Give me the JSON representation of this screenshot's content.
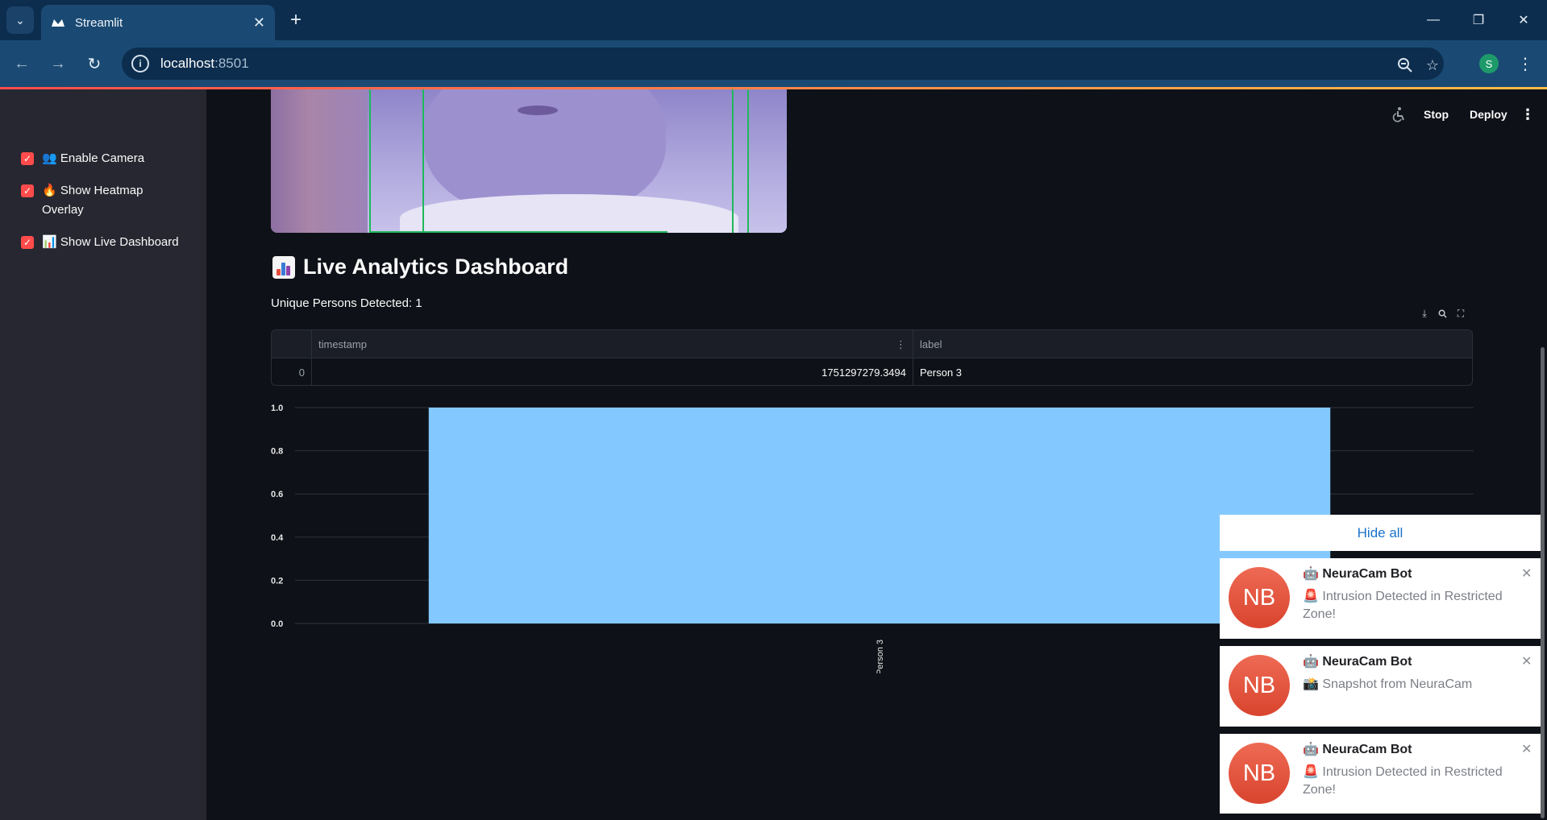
{
  "browser": {
    "tab_title": "Streamlit",
    "url_host": "localhost",
    "url_port": ":8501",
    "profile_initial": "S"
  },
  "sidebar": {
    "items": [
      {
        "icon": "👥",
        "label": "Enable Camera",
        "checked": true
      },
      {
        "icon": "🔥",
        "label": "Show Heatmap Overlay",
        "checked": true
      },
      {
        "icon": "📊",
        "label": "Show Live Dashboard",
        "checked": true
      }
    ]
  },
  "header": {
    "stop_label": "Stop",
    "deploy_label": "Deploy"
  },
  "dashboard": {
    "title": "Live Analytics Dashboard",
    "unique_persons": "Unique Persons Detected: 1",
    "table": {
      "columns": [
        "timestamp",
        "label"
      ],
      "rows": [
        {
          "index": "0",
          "timestamp": "1751297279.3494",
          "label": "Person 3"
        }
      ]
    }
  },
  "chart_data": {
    "type": "bar",
    "categories": [
      "Person 3"
    ],
    "values": [
      1
    ],
    "ylim": [
      0,
      1
    ],
    "yticks": [
      "0.0",
      "0.2",
      "0.4",
      "0.6",
      "0.8",
      "1.0"
    ],
    "color": "#83c9ff",
    "grid": true
  },
  "notifications": {
    "hide_all_label": "Hide all",
    "items": [
      {
        "avatar": "NB",
        "sender": "NeuraCam Bot",
        "emoji": "🚨",
        "message": "Intrusion Detected in Restricted Zone!"
      },
      {
        "avatar": "NB",
        "sender": "NeuraCam Bot",
        "emoji": "📸",
        "message": "Snapshot from NeuraCam"
      },
      {
        "avatar": "NB",
        "sender": "NeuraCam Bot",
        "emoji": "🚨",
        "message": "Intrusion Detected in Restricted Zone!"
      }
    ]
  }
}
